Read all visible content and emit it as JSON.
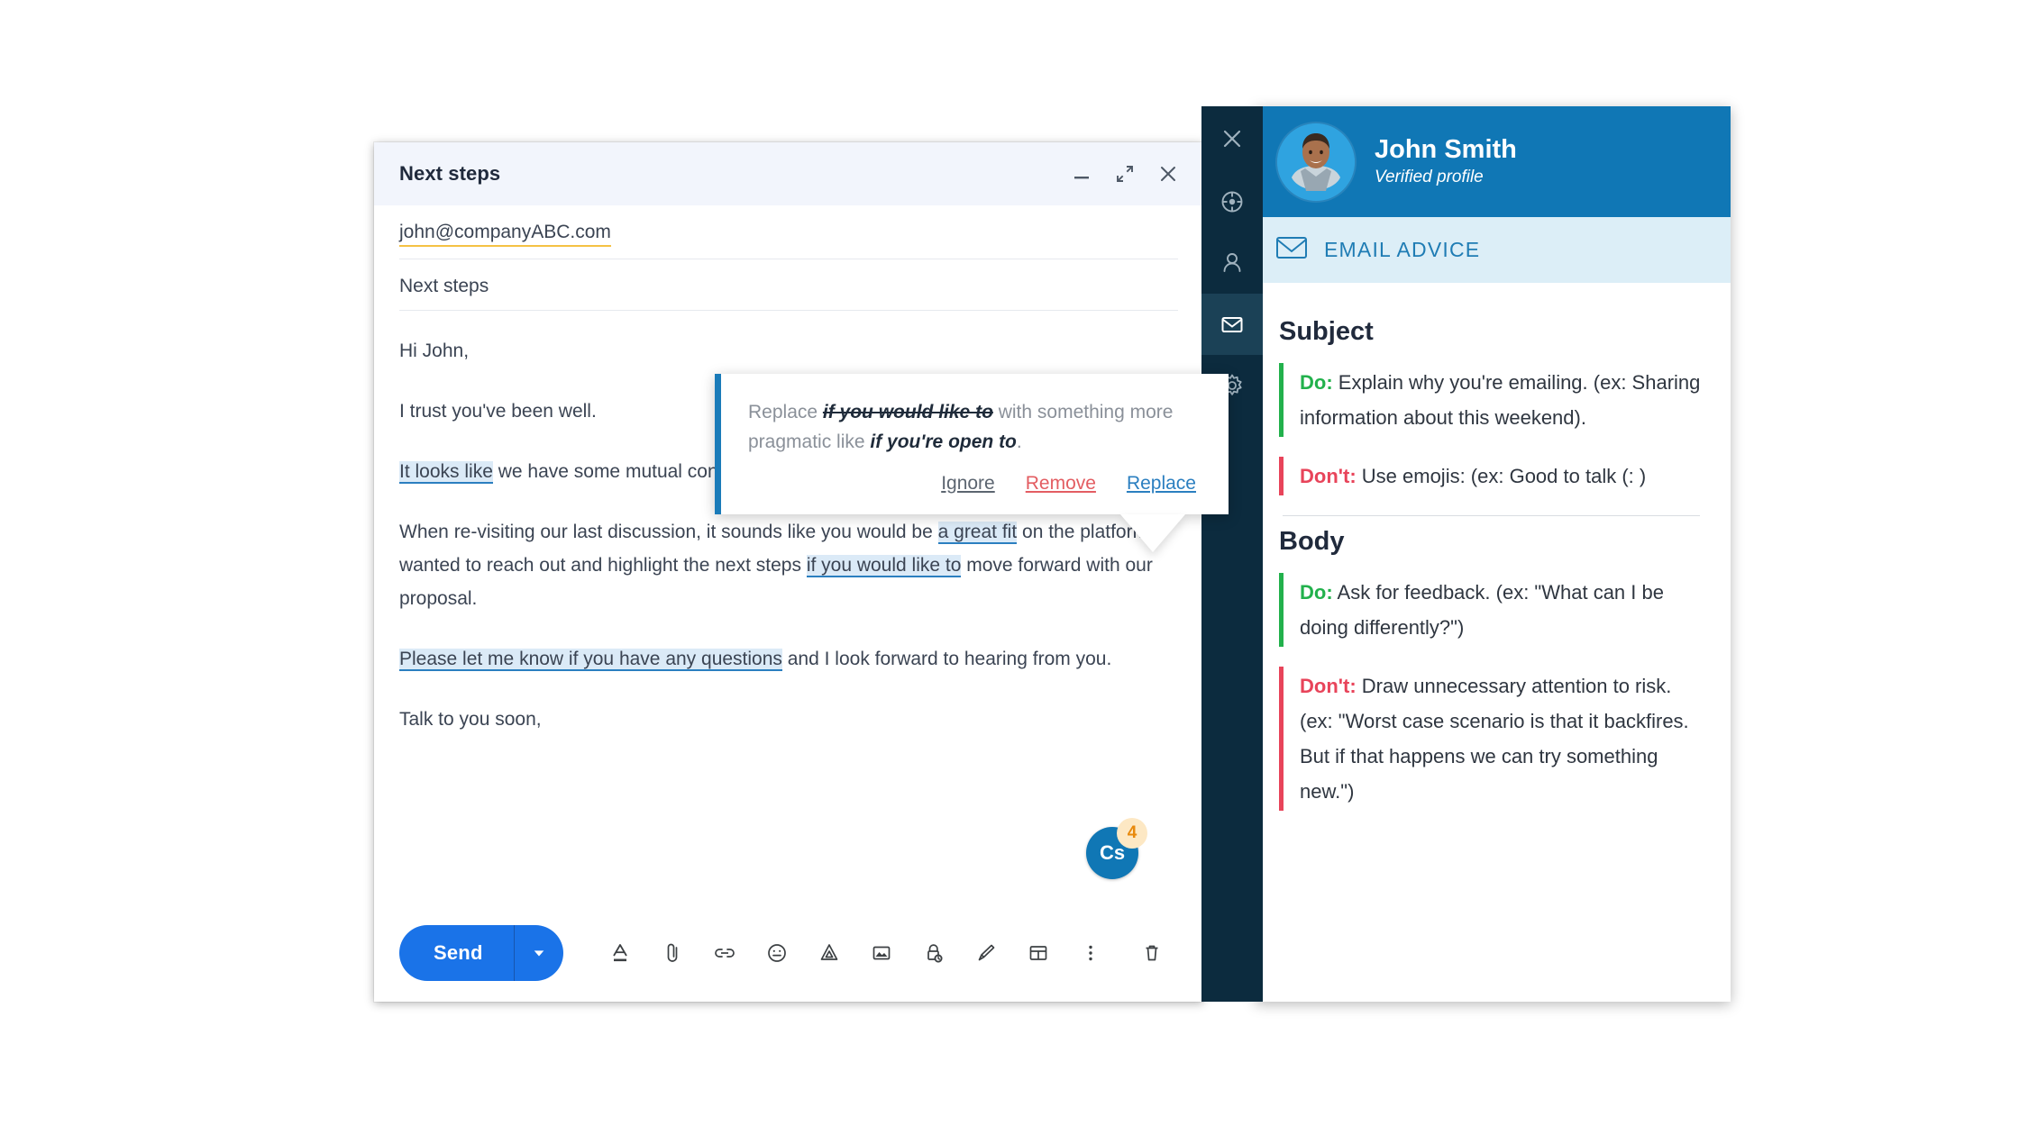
{
  "compose": {
    "title": "Next steps",
    "window_controls": [
      {
        "name": "minimize",
        "glyph": "minimize-icon"
      },
      {
        "name": "expand",
        "glyph": "expand-icon"
      },
      {
        "name": "close",
        "glyph": "close-icon"
      }
    ],
    "to": "john@companyABC.com",
    "subject": "Next steps",
    "body": {
      "greeting": "Hi John,",
      "line2": "I trust you've been well.",
      "p3_hl": "It looks like",
      "p3_rest": " we have some mutual connections.",
      "p4_a": "When re-visiting our last discussion, it sounds like you would be ",
      "p4_hl1": "a great fit",
      "p4_b": " on the platform. I wanted to reach out and highlight the next steps ",
      "p4_hl2": "if you would like to",
      "p4_c": " move forward with our proposal.",
      "p5_hl": "Please let me know if you have any questions",
      "p5_rest": " and I look forward to hearing from you.",
      "closing": "Talk to you soon,"
    },
    "toolbar": {
      "send_label": "Send",
      "send_caret": "caret-down-icon",
      "icons": [
        {
          "name": "format-text-icon",
          "title": "Formatting options"
        },
        {
          "name": "attach-file-icon",
          "title": "Attach files"
        },
        {
          "name": "insert-link-icon",
          "title": "Insert link"
        },
        {
          "name": "insert-emoji-icon",
          "title": "Insert emoji"
        },
        {
          "name": "insert-drive-file-icon",
          "title": "Insert files using Drive"
        },
        {
          "name": "insert-photo-icon",
          "title": "Insert photo"
        },
        {
          "name": "confidential-mode-icon",
          "title": "Toggle confidential mode"
        },
        {
          "name": "insert-signature-icon",
          "title": "Insert signature"
        },
        {
          "name": "insert-template-icon",
          "title": "More options"
        },
        {
          "name": "more-options-icon",
          "title": "More options"
        },
        {
          "name": "discard-draft-icon",
          "title": "Discard draft"
        }
      ]
    },
    "assistant_badge": {
      "initials": "Cs",
      "count": "4"
    }
  },
  "suggestion": {
    "prefix": "Replace ",
    "strike": "if you would like to",
    "middle": " with something more pragmatic like ",
    "suggestion": "if you're open to",
    "suffix": ".",
    "actions": {
      "ignore": "Ignore",
      "remove": "Remove",
      "replace": "Replace"
    }
  },
  "rail": {
    "items": [
      {
        "name": "close-panel-icon",
        "active": false
      },
      {
        "name": "target-icon",
        "active": false
      },
      {
        "name": "person-icon",
        "active": false
      },
      {
        "name": "email-icon",
        "active": true
      },
      {
        "name": "settings-gear-icon",
        "active": false
      }
    ]
  },
  "panel": {
    "profile": {
      "name": "John Smith",
      "status": "Verified profile"
    },
    "tab": {
      "icon": "envelope-icon",
      "label": "EMAIL ADVICE"
    },
    "sections": [
      {
        "title": "Subject",
        "items": [
          {
            "kind": "Do:",
            "type": "do",
            "text": " Explain why you're emailing. (ex: Sharing information about this weekend)."
          },
          {
            "kind": "Don't:",
            "type": "dont",
            "text": " Use emojis: (ex: Good to talk (: )"
          }
        ]
      },
      {
        "title": "Body",
        "items": [
          {
            "kind": "Do:",
            "type": "do",
            "text": " Ask for feedback. (ex: \"What can I be doing differently?\")"
          },
          {
            "kind": "Don't:",
            "type": "dont",
            "text": " Draw unnecessary attention to risk. (ex: \"Worst case scenario is that it backfires. But if that happens we can try something new.\")"
          }
        ]
      }
    ]
  },
  "colors": {
    "send_blue": "#1a73e8",
    "panel_blue": "#1077b5",
    "rail_dark": "#0c2b3e",
    "tab_bg": "#dceef7",
    "do_green": "#22b14c",
    "dont_red": "#e8445a",
    "highlight": "#dbeaf7",
    "accent_underline": "#2b7fc0",
    "to_underline": "#f5c244"
  }
}
